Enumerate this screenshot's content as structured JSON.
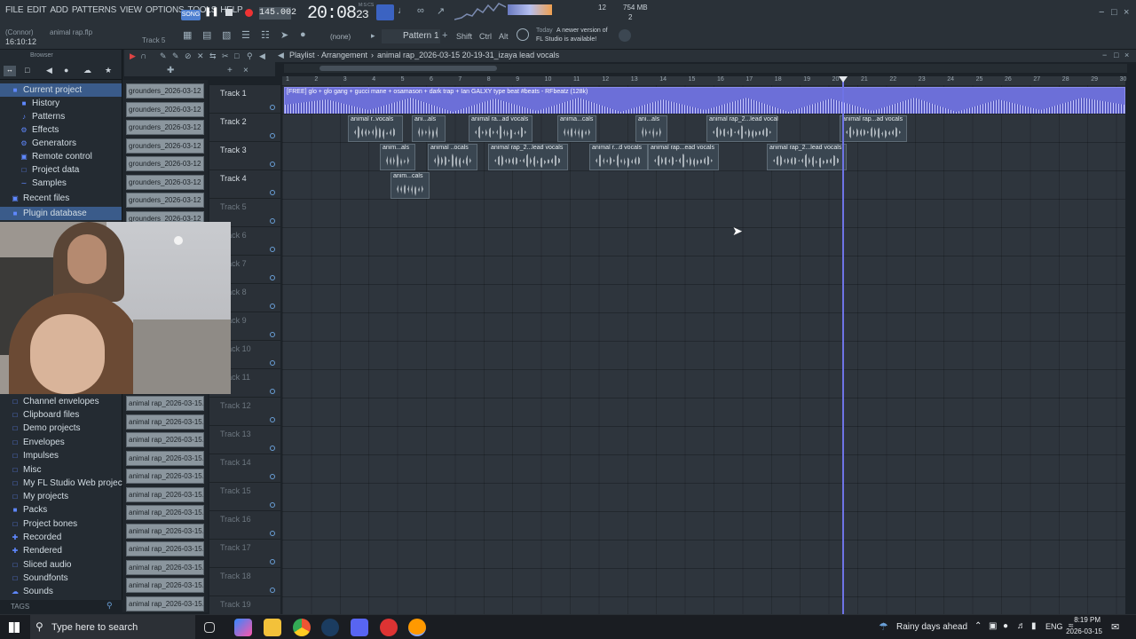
{
  "menu": [
    "FILE",
    "EDIT",
    "ADD",
    "PATTERNS",
    "VIEW",
    "OPTIONS",
    "TOOLS",
    "HELP"
  ],
  "transport": {
    "mode": "SONG",
    "tempo": "145.002",
    "time": "20:08",
    "time_sub": "23",
    "bars_label": "M:S:CS",
    "memory": "754 MB",
    "cpu_val": "12",
    "poly": "2"
  },
  "hint": {
    "user": "(Connor)",
    "file": "animal rap.flp",
    "time": "16:10:12",
    "track": "Track 5"
  },
  "pattern": {
    "snap": "(none)",
    "name": "Pattern 1"
  },
  "toggles": [
    "Shift",
    "Ctrl",
    "Alt"
  ],
  "news": {
    "line1": "Today",
    "line2": "A newer version of",
    "line3": "FL Studio is available!"
  },
  "browser": {
    "title": "Browser",
    "items_top": [
      "Current project",
      "History",
      "Patterns",
      "Effects",
      "Generators",
      "Remote control",
      "Project data",
      "Samples",
      "Recent files",
      "Plugin database"
    ],
    "items_bottom": [
      "Channel envelopes",
      "Clipboard files",
      "Demo projects",
      "Envelopes",
      "Impulses",
      "Misc",
      "My FL Studio Web projects",
      "My projects",
      "Packs",
      "Project bones",
      "Recorded",
      "Rendered",
      "Sliced audio",
      "Soundfonts",
      "Sounds"
    ],
    "tags": "TAGS"
  },
  "files_top": [
    "grounders_2026-03-12 1...",
    "grounders_2026-03-12 1...",
    "grounders_2026-03-12 1...",
    "grounders_2026-03-12 1...",
    "grounders_2026-03-12 1...",
    "grounders_2026-03-12 1...",
    "grounders_2026-03-12 1...",
    "grounders_2026-03-12 1..."
  ],
  "files_bottom": [
    "animal rap_2026-03-15...",
    "animal rap_2026-03-15...",
    "animal rap_2026-03-15...",
    "animal rap_2026-03-15...",
    "animal rap_2026-03-15...",
    "animal rap_2026-03-15...",
    "animal rap_2026-03-15...",
    "animal rap_2026-03-15...",
    "animal rap_2026-03-15...",
    "animal rap_2026-03-15...",
    "animal rap_2026-03-15...",
    "animal rap_2026-03-15..."
  ],
  "playlist": {
    "title": "Playlist · Arrangement",
    "breadcrumb": "animal rap_2026-03-15 20-19-31_izaya lead vocals"
  },
  "ruler": [
    "1",
    "2",
    "3",
    "4",
    "5",
    "6",
    "7",
    "8",
    "9",
    "10",
    "11",
    "12",
    "13",
    "14",
    "15",
    "16",
    "17",
    "18",
    "19",
    "20",
    "21",
    "22",
    "23",
    "24",
    "25",
    "26",
    "27",
    "28",
    "29",
    "30"
  ],
  "tracks": [
    "Track 1",
    "Track 2",
    "Track 3",
    "Track 4",
    "Track 5",
    "Track 6",
    "Track 7",
    "Track 8",
    "Track 9",
    "Track 10",
    "Track 11",
    "Track 12",
    "Track 13",
    "Track 14",
    "Track 15",
    "Track 16",
    "Track 17",
    "Track 18",
    "Track 19"
  ],
  "beat_clip": "[FREE] glo + glo gang + gucci mane + osamason + dark trap + Ian GALXY type beat #beats - RFbeatz (128k)",
  "clips_t2": [
    "animal r..vocals",
    "ani...als",
    "animal ra...ad vocals",
    "anima...cals",
    "ani...als",
    "animal rap_2...lead vocals",
    "animal rap...ad vocals"
  ],
  "clips_t3": [
    "anim...als",
    "animal ..ocals",
    "animal rap_2...lead vocals",
    "animal r...d vocals",
    "animal rap...ead vocals",
    "animal rap_2...lead vocals"
  ],
  "clips_t4": [
    "anim...cals"
  ],
  "taskbar": {
    "search": "Type here to search",
    "weather": "Rainy days ahead",
    "lang": "ENG",
    "clock": "8:19 PM",
    "date": "2026-03-15"
  },
  "colors": {
    "accent": "#6c6fd8",
    "bg": "#2e353d"
  }
}
